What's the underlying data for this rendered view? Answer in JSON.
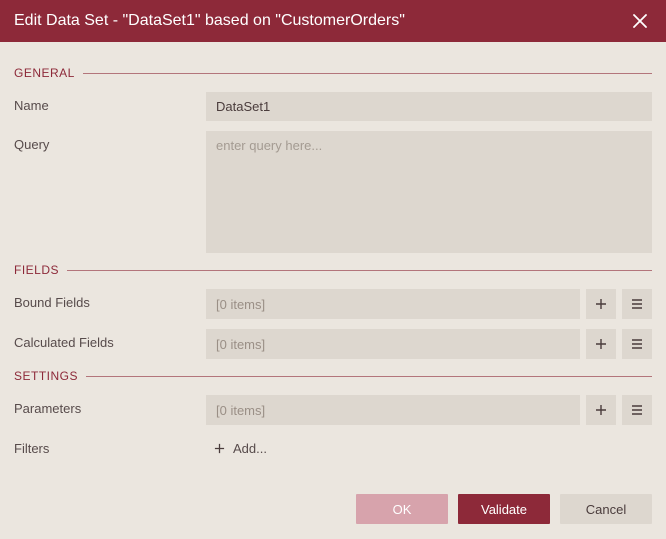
{
  "titlebar": {
    "title": "Edit Data Set - \"DataSet1\" based on \"CustomerOrders\""
  },
  "sections": {
    "general": "GENERAL",
    "fields": "FIELDS",
    "settings": "SETTINGS"
  },
  "general": {
    "name_label": "Name",
    "name_value": "DataSet1",
    "query_label": "Query",
    "query_value": "",
    "query_placeholder": "enter query here..."
  },
  "fields": {
    "bound_label": "Bound Fields",
    "bound_items": "[0 items]",
    "calc_label": "Calculated Fields",
    "calc_items": "[0 items]"
  },
  "settings": {
    "params_label": "Parameters",
    "params_items": "[0 items]",
    "filters_label": "Filters",
    "filters_add": "Add..."
  },
  "footer": {
    "ok": "OK",
    "validate": "Validate",
    "cancel": "Cancel"
  }
}
